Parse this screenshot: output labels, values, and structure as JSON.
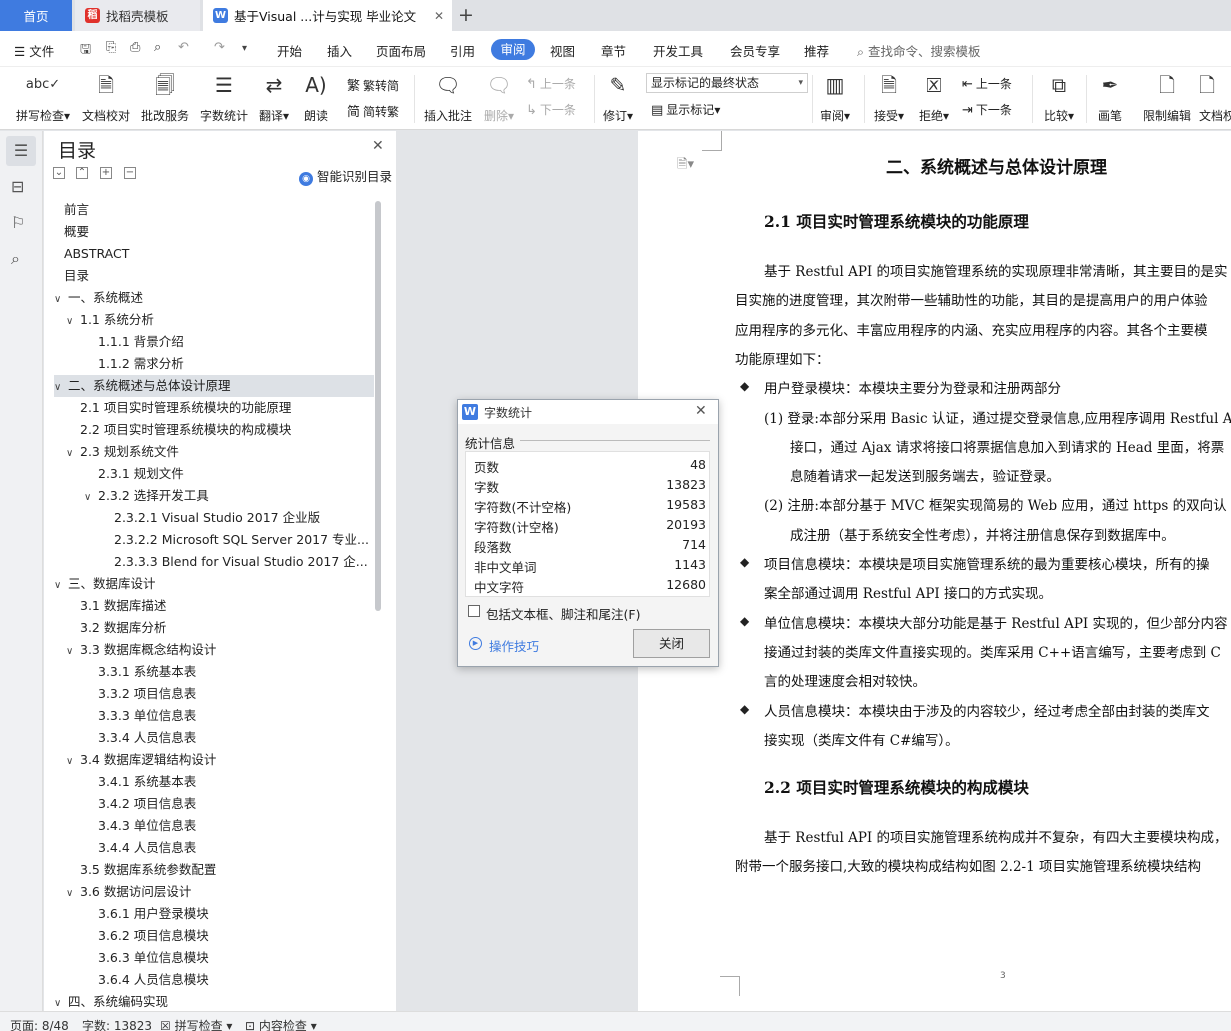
{
  "tabs": {
    "home": "首页",
    "docer": "找稻壳模板",
    "doc": "基于Visual ...计与实现 毕业论文"
  },
  "menu": {
    "file": "文件",
    "items": [
      "开始",
      "插入",
      "页面布局",
      "引用"
    ],
    "review": "审阅",
    "items2": [
      "视图",
      "章节",
      "开发工具",
      "会员专享",
      "推荐"
    ],
    "search": "查找命令、搜索模板"
  },
  "ribbon": {
    "spell": "拼写检查",
    "proof": "文档校对",
    "annot": "批改服务",
    "wordcount": "字数统计",
    "translate": "翻译",
    "read": "朗读",
    "trad": "繁转简",
    "simp": "简转繁",
    "insert_comment": "插入批注",
    "delete": "删除",
    "prev": "上一条",
    "next": "下一条",
    "revise": "修订",
    "markup_state": "显示标记的最终状态",
    "show_markup": "显示标记",
    "review_pane": "审阅",
    "accept": "接受",
    "reject": "拒绝",
    "prev2": "上一条",
    "next2": "下一条",
    "compare": "比较",
    "ink": "画笔",
    "restrict": "限制编辑",
    "doc_perm": "文档权"
  },
  "toc": {
    "title": "目录",
    "smart": "智能识别目录",
    "items": [
      {
        "text": "前言",
        "level": 0,
        "toggle": ""
      },
      {
        "text": "概要",
        "level": 0,
        "toggle": ""
      },
      {
        "text": "ABSTRACT",
        "level": 0,
        "toggle": ""
      },
      {
        "text": "目录",
        "level": 0,
        "toggle": ""
      },
      {
        "text": "一、系统概述",
        "level": 0,
        "toggle": "∨"
      },
      {
        "text": "1.1 系统分析",
        "level": 1,
        "toggle": "∨"
      },
      {
        "text": "1.1.1 背景介绍",
        "level": 2,
        "toggle": ""
      },
      {
        "text": "1.1.2 需求分析",
        "level": 2,
        "toggle": ""
      },
      {
        "text": "二、系统概述与总体设计原理",
        "level": 0,
        "toggle": "∨",
        "selected": true
      },
      {
        "text": "2.1 项目实时管理系统模块的功能原理",
        "level": 1,
        "toggle": ""
      },
      {
        "text": "2.2 项目实时管理系统模块的构成模块",
        "level": 1,
        "toggle": ""
      },
      {
        "text": "2.3 规划系统文件",
        "level": 1,
        "toggle": "∨"
      },
      {
        "text": "2.3.1 规划文件",
        "level": 2,
        "toggle": ""
      },
      {
        "text": "2.3.2 选择开发工具",
        "level": 2,
        "toggle": "∨"
      },
      {
        "text": "2.3.2.1 Visual Studio 2017  企业版",
        "level": 3,
        "toggle": ""
      },
      {
        "text": "2.3.2.2 Microsoft SQL Server 2017  专业...",
        "level": 3,
        "toggle": ""
      },
      {
        "text": "2.3.3.3 Blend for Visual Studio 2017  企...",
        "level": 3,
        "toggle": ""
      },
      {
        "text": "三、数据库设计",
        "level": 0,
        "toggle": "∨"
      },
      {
        "text": "3.1 数据库描述",
        "level": 1,
        "toggle": ""
      },
      {
        "text": "3.2 数据库分析",
        "level": 1,
        "toggle": ""
      },
      {
        "text": "3.3 数据库概念结构设计",
        "level": 1,
        "toggle": "∨"
      },
      {
        "text": "3.3.1 系统基本表",
        "level": 2,
        "toggle": ""
      },
      {
        "text": "3.3.2 项目信息表",
        "level": 2,
        "toggle": ""
      },
      {
        "text": "3.3.3 单位信息表",
        "level": 2,
        "toggle": ""
      },
      {
        "text": "3.3.4 人员信息表",
        "level": 2,
        "toggle": ""
      },
      {
        "text": "3.4 数据库逻辑结构设计",
        "level": 1,
        "toggle": "∨"
      },
      {
        "text": "3.4.1 系统基本表",
        "level": 2,
        "toggle": ""
      },
      {
        "text": "3.4.2 项目信息表",
        "level": 2,
        "toggle": ""
      },
      {
        "text": "3.4.3 单位信息表",
        "level": 2,
        "toggle": ""
      },
      {
        "text": "3.4.4 人员信息表",
        "level": 2,
        "toggle": ""
      },
      {
        "text": "3.5 数据库系统参数配置",
        "level": 1,
        "toggle": ""
      },
      {
        "text": "3.6 数据访问层设计",
        "level": 1,
        "toggle": "∨"
      },
      {
        "text": "3.6.1  用户登录模块",
        "level": 2,
        "toggle": ""
      },
      {
        "text": "3.6.2  项目信息模块",
        "level": 2,
        "toggle": ""
      },
      {
        "text": "3.6.3  单位信息模块",
        "level": 2,
        "toggle": ""
      },
      {
        "text": "3.6.4  人员信息模块",
        "level": 2,
        "toggle": ""
      },
      {
        "text": "四、系统编码实现",
        "level": 0,
        "toggle": "∨"
      }
    ]
  },
  "document": {
    "heading": "二、系统概述与总体设计原理",
    "lines": [
      {
        "type": "h2",
        "text": "2.1 项目实时管理系统模块的功能原理"
      },
      {
        "type": "p",
        "indent": true,
        "text": "基于 Restful API 的项目实施管理系统的实现原理非常清晰，其主要目的是实"
      },
      {
        "type": "p",
        "text": "目实施的进度管理，其次附带一些辅助性的功能，其目的是提高用户的用户体验"
      },
      {
        "type": "p",
        "text": "应用程序的多元化、丰富应用程序的内涵、充实应用程序的内容。其各个主要模"
      },
      {
        "type": "p",
        "text": "功能原理如下："
      },
      {
        "type": "b",
        "text": "用户登录模块：本模块主要分为登录和注册两部分"
      },
      {
        "type": "n",
        "text": "(1)  登录:本部分采用 Basic 认证，通过提交登录信息,应用程序调用 Restful A"
      },
      {
        "type": "c",
        "text": "接口，通过 Ajax 请求将接口将票据信息加入到请求的 Head 里面，将票"
      },
      {
        "type": "c",
        "text": "息随着请求一起发送到服务端去，验证登录。"
      },
      {
        "type": "n",
        "text": "(2)  注册:本部分基于 MVC 框架实现简易的 Web 应用，通过 https 的双向认"
      },
      {
        "type": "c",
        "text": "成注册（基于系统安全性考虑），并将注册信息保存到数据库中。"
      },
      {
        "type": "b",
        "text": "项目信息模块：本模块是项目实施管理系统的最为重要核心模块，所有的操"
      },
      {
        "type": "c2",
        "text": "案全部通过调用 Restful API 接口的方式实现。"
      },
      {
        "type": "b",
        "text": "单位信息模块：本模块大部分功能是基于 Restful API 实现的，但少部分内容"
      },
      {
        "type": "c2",
        "text": "接通过封装的类库文件直接实现的。类库采用 C++语言编写，主要考虑到 C"
      },
      {
        "type": "c2",
        "text": "言的处理速度会相对较快。"
      },
      {
        "type": "b",
        "text": "人员信息模块：本模块由于涉及的内容较少，经过考虑全部由封装的类库文"
      },
      {
        "type": "c2",
        "text": "接实现（类库文件有 C#编写）。"
      },
      {
        "type": "h2",
        "text": "2.2 项目实时管理系统模块的构成模块"
      },
      {
        "type": "p",
        "indent": true,
        "text": "基于 Restful API 的项目实施管理系统构成并不复杂，有四大主要模块构成，"
      },
      {
        "type": "p",
        "text": "附带一个服务接口,大致的模块构成结构如图 2.2-1 项目实施管理系统模块结构"
      }
    ],
    "page_number": "3"
  },
  "dialog": {
    "title": "字数统计",
    "section": "统计信息",
    "stats": [
      {
        "label": "页数",
        "value": "48"
      },
      {
        "label": "字数",
        "value": "13823"
      },
      {
        "label": "字符数(不计空格)",
        "value": "19583"
      },
      {
        "label": "字符数(计空格)",
        "value": "20193"
      },
      {
        "label": "段落数",
        "value": "714"
      },
      {
        "label": "非中文单词",
        "value": "1143"
      },
      {
        "label": "中文字符",
        "value": "12680"
      }
    ],
    "include_label": "包括文本框、脚注和尾注(F)",
    "tips": "操作技巧",
    "close": "关闭"
  },
  "status": {
    "page": "页面: 8/48",
    "words": "字数: 13823",
    "spell": "拼写检查",
    "content": "内容检查"
  }
}
